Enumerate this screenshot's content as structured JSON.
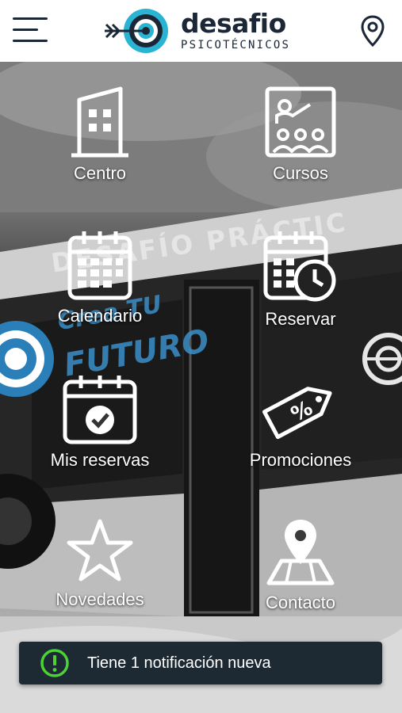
{
  "header": {
    "logo_word": "desafio",
    "logo_sub": "PSICOTÉCNICOS"
  },
  "background": {
    "bus_lettering": "DESAFÍO PRÁCTIC",
    "graffiti_line1": "Crea TU",
    "graffiti_line2": "FUTURO"
  },
  "menu": {
    "items": [
      {
        "label": "Centro",
        "icon": "building-icon"
      },
      {
        "label": "Cursos",
        "icon": "classroom-icon"
      },
      {
        "label": "Calendario",
        "icon": "calendar-icon"
      },
      {
        "label": "Reservar",
        "icon": "calendar-clock-icon"
      },
      {
        "label": "Mis reservas",
        "icon": "calendar-check-icon"
      },
      {
        "label": "Promociones",
        "icon": "discount-tag-icon"
      },
      {
        "label": "Novedades",
        "icon": "star-icon"
      },
      {
        "label": "Contacto",
        "icon": "map-pin-icon"
      }
    ]
  },
  "notification": {
    "text": "Tiene 1 notificación nueva",
    "icon": "alert-circle-icon"
  },
  "colors": {
    "brand_dark": "#1b2636",
    "brand_cyan": "#2ab4d4",
    "toast_bg": "#1e2a33",
    "toast_accent": "#4cd137"
  }
}
